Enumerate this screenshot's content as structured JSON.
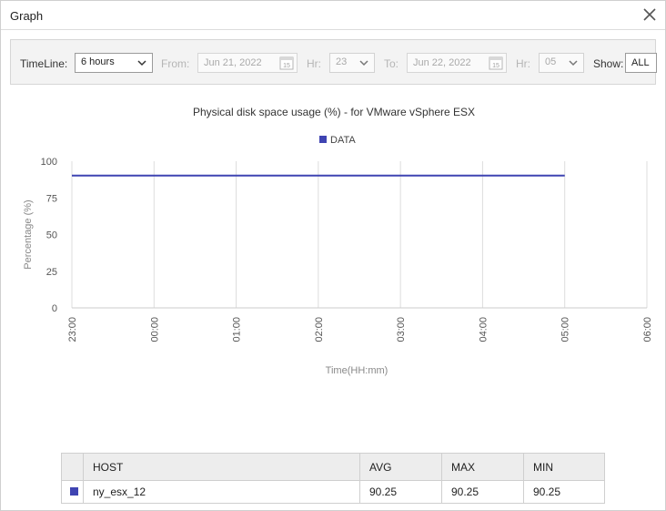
{
  "window": {
    "title": "Graph"
  },
  "filters": {
    "timeline_label": "TimeLine:",
    "timeline_value": "6 hours",
    "from_label": "From:",
    "from_date": "Jun 21, 2022",
    "from_hr_label": "Hr:",
    "from_hr": "23",
    "to_label": "To:",
    "to_date": "Jun 22, 2022",
    "to_hr_label": "Hr:",
    "to_hr": "05",
    "show_label": "Show:",
    "show_value": "ALL",
    "calendar_day": "15"
  },
  "colors": {
    "series": "#3f44b2",
    "grid": "#dddddd",
    "axis_text": "#555555"
  },
  "chart_data": {
    "type": "line",
    "title": "Physical disk space usage (%) - for VMware vSphere ESX",
    "xlabel": "Time(HH:mm)",
    "ylabel": "Percentage (%)",
    "x_ticks": [
      "23:00",
      "00:00",
      "01:00",
      "02:00",
      "03:00",
      "04:00",
      "05:00",
      "06:00"
    ],
    "y_ticks": [
      0,
      25,
      50,
      75,
      100
    ],
    "ylim": [
      0,
      100
    ],
    "legend_position": "top-center",
    "grid": true,
    "series": [
      {
        "name": "DATA",
        "x": [
          "23:00",
          "05:00"
        ],
        "y": [
          90.25,
          90.25
        ]
      }
    ]
  },
  "table": {
    "headers": {
      "host": "HOST",
      "avg": "AVG",
      "max": "MAX",
      "min": "MIN"
    },
    "rows": [
      {
        "host": "ny_esx_12",
        "avg": "90.25",
        "max": "90.25",
        "min": "90.25"
      }
    ]
  }
}
